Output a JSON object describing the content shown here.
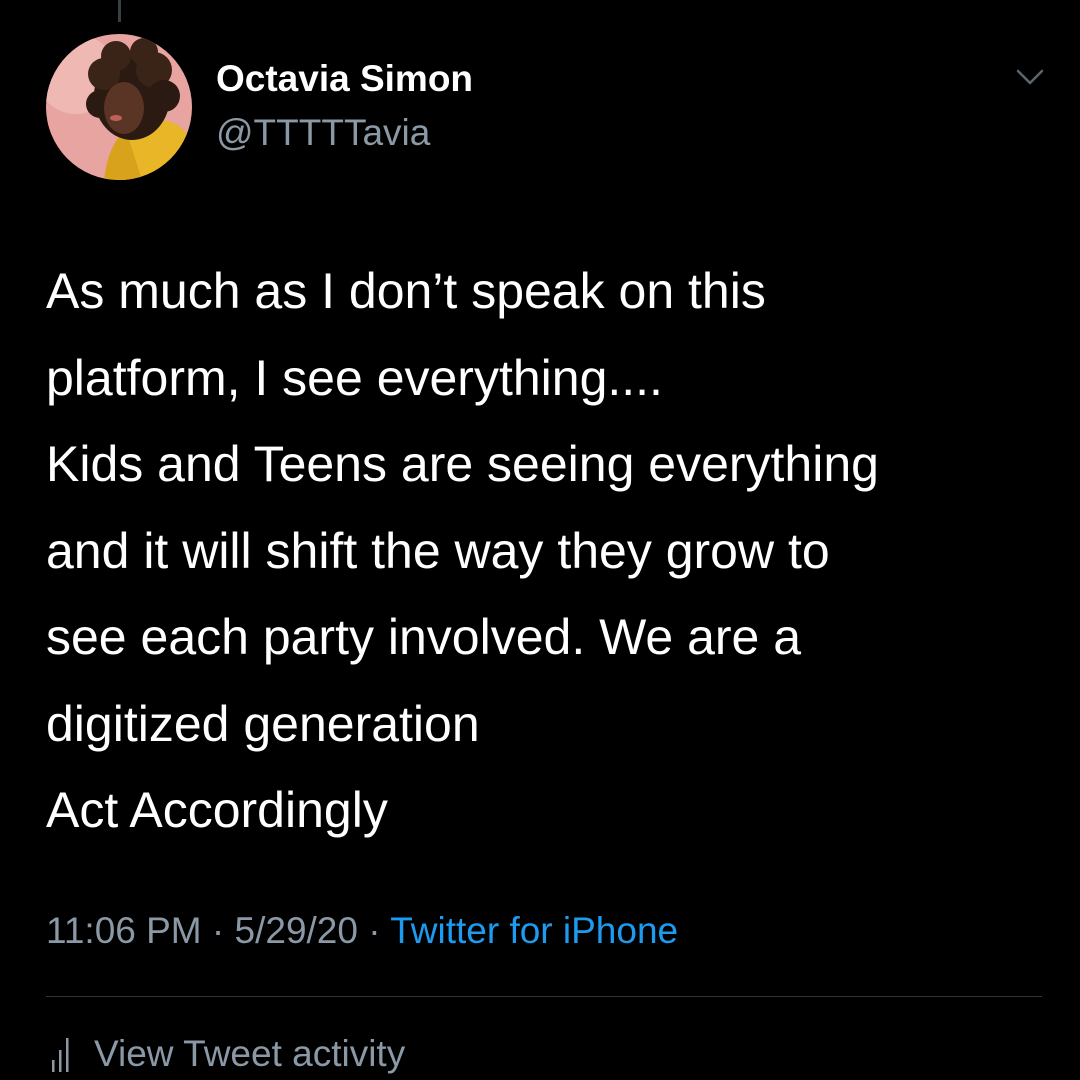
{
  "tweet": {
    "author": {
      "display_name": "Octavia Simon",
      "handle": "@TTTTTavia",
      "avatar_icon": "profile-photo"
    },
    "menu_icon": "chevron-down-icon",
    "text_lines": [
      "As much as I don’t speak on this",
      "platform, I see everything....",
      "Kids and Teens are seeing everything",
      "and it will shift the way they grow to",
      "see each party involved. We are a",
      "digitized generation",
      "Act Accordingly"
    ],
    "meta": {
      "time": "11:06 PM",
      "separator": "·",
      "date": "5/29/20",
      "source": "Twitter for iPhone"
    },
    "activity": {
      "label": "View Tweet activity",
      "icon": "bar-chart-icon"
    }
  },
  "colors": {
    "background": "#000000",
    "primary_text": "#ffffff",
    "secondary_text": "#8b98a5",
    "link": "#1d9bf0",
    "divider": "#2f3336"
  }
}
